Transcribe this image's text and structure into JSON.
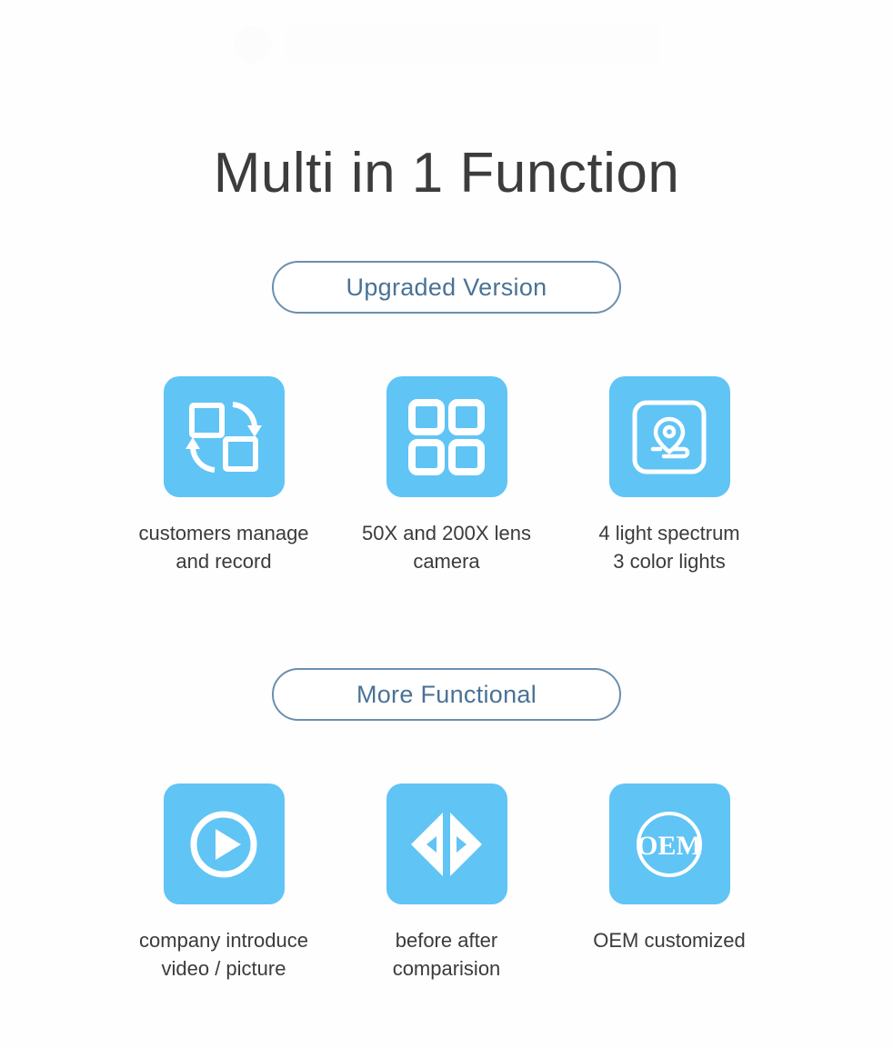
{
  "header": {
    "watermark_text": "",
    "badge_icon": "seal-watermark-icon",
    "bar_icon": "banner-watermark-icon"
  },
  "page_title": "Multi in 1 Function",
  "colors": {
    "tile_blue": "#60c4f5",
    "pill_border": "#6b8fae",
    "pill_text": "#4a7296",
    "title_text": "#3c3c3c",
    "caption_text": "#3b3b3b",
    "background": "#fefeff"
  },
  "sections": [
    {
      "pill_label": "Upgraded Version",
      "features": [
        {
          "icon": "transfer-squares-icon",
          "caption": "customers manage\nand record"
        },
        {
          "icon": "grid-four-squares-icon",
          "caption": "50X and 200X lens\ncamera"
        },
        {
          "icon": "map-location-pin-icon",
          "caption": "4 light spectrum\n3 color lights"
        }
      ]
    },
    {
      "pill_label": "More Functional",
      "features": [
        {
          "icon": "play-circle-icon",
          "caption": "company introduce\nvideo / picture"
        },
        {
          "icon": "before-after-compare-icon",
          "caption": "before after\ncomparision"
        },
        {
          "icon": "oem-circle-icon",
          "caption": "OEM customized"
        }
      ]
    }
  ]
}
